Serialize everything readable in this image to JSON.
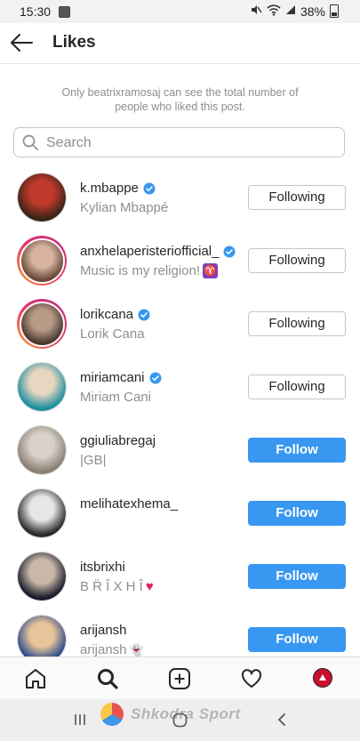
{
  "status_bar": {
    "time": "15:30",
    "battery": "38%",
    "icons": [
      "notification-icon",
      "mute-icon",
      "wifi-icon",
      "signal-icon",
      "battery-icon"
    ]
  },
  "header": {
    "title": "Likes",
    "back_icon": "arrow-left-icon"
  },
  "notice": "Only beatrixramosaj can see the total number of people who liked this post.",
  "search": {
    "placeholder": "Search",
    "value": ""
  },
  "likers": [
    {
      "username": "k.mbappe",
      "fullname": "Kylian Mbappé",
      "verified": true,
      "story": false,
      "button": "Following"
    },
    {
      "username": "anxhelaperisteriofficial_",
      "fullname": "Music is my religion!",
      "verified": true,
      "story": true,
      "button": "Following",
      "emoji": "aries-icon"
    },
    {
      "username": "lorikcana",
      "fullname": "Lorik Cana",
      "verified": true,
      "story": true,
      "button": "Following"
    },
    {
      "username": "miriamcani",
      "fullname": "Miriam Cani",
      "verified": true,
      "story": false,
      "button": "Following"
    },
    {
      "username": "ggiuliabregaj",
      "fullname": "|GB|",
      "verified": false,
      "story": false,
      "button": "Follow"
    },
    {
      "username": "melihatexhema_",
      "fullname": "",
      "verified": false,
      "story": false,
      "button": "Follow"
    },
    {
      "username": "itsbrixhi",
      "fullname": "B R̈ Î X H Î",
      "verified": false,
      "story": false,
      "button": "Follow",
      "emoji": "heart-icon"
    },
    {
      "username": "arijansh",
      "fullname": "arijansh",
      "verified": false,
      "story": false,
      "button": "Follow",
      "emoji": "ghost-icon"
    }
  ],
  "bottom_nav": [
    "home-icon",
    "search-icon",
    "add-post-icon",
    "activity-heart-icon",
    "profile-avatar"
  ],
  "watermark": "Shkodra Sport",
  "colors": {
    "follow_blue": "#3897f0",
    "verified_blue": "#3897f0",
    "secondary_text": "#8e8e8e",
    "border": "#c7c7c7"
  }
}
